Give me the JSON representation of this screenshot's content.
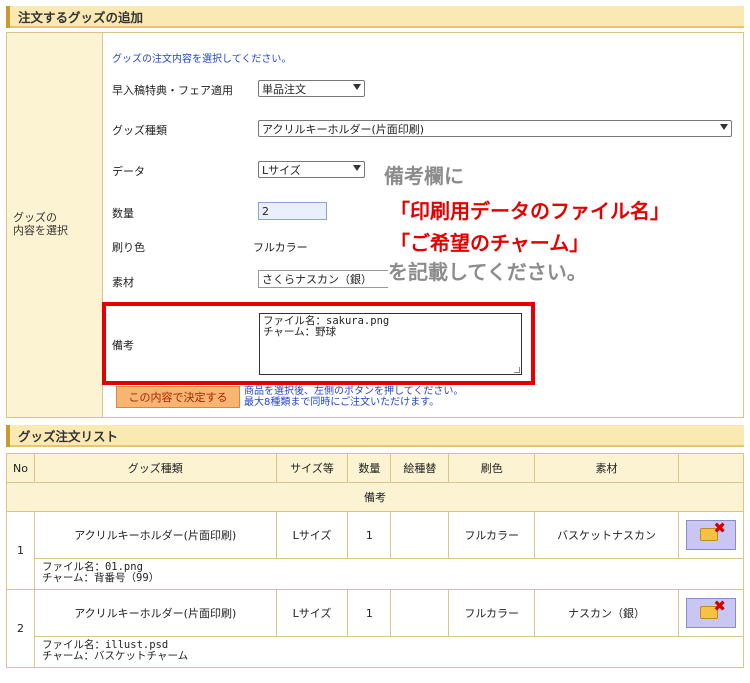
{
  "section1": {
    "title": "注文するグッズの追加"
  },
  "form": {
    "left_label": [
      "グッズの",
      "内容を選択"
    ],
    "instruction": "グッズの注文内容を選択してください。",
    "early_label": "早入稿特典・フェア適用",
    "early_value": "単品注文",
    "type_label": "グッズ種類",
    "type_value": "アクリルキーホルダー(片面印刷)",
    "data_label": "データ",
    "data_value": "Lサイズ",
    "qty_label": "数量",
    "qty_value": "2",
    "color_label": "刷り色",
    "color_value": "フルカラー",
    "material_label": "素材",
    "material_value": "さくらナスカン（銀）",
    "remarks_label": "備考",
    "remarks_lines": [
      "ファイル名：sakura.png",
      "チャーム：野球"
    ],
    "submit_label": "この内容で決定する",
    "note_lines": [
      "商品を選択後、左側のボタンを押してください。",
      "最大8種類まで同時にご注文いただけます。"
    ]
  },
  "overlay": {
    "line1": "備考欄に",
    "line2": "「印刷用データのファイル名」",
    "line3": "「ご希望のチャーム」",
    "line4": "を記載してください。"
  },
  "section2": {
    "title": "グッズ注文リスト"
  },
  "list": {
    "headers": [
      "No",
      "グッズ種類",
      "サイズ等",
      "数量",
      "絵種替",
      "刷色",
      "素材",
      ""
    ],
    "remarks_header": "備考",
    "rows": [
      {
        "no": "1",
        "type": "アクリルキーホルダー(片面印刷)",
        "size": "Lサイズ",
        "qty": "1",
        "swap": "",
        "color": "フルカラー",
        "material": "バスケットナスカン",
        "remarks": [
          "ファイル名：01.png",
          "チャーム：背番号（99）"
        ]
      },
      {
        "no": "2",
        "type": "アクリルキーホルダー(片面印刷)",
        "size": "Lサイズ",
        "qty": "1",
        "swap": "",
        "color": "フルカラー",
        "material": "ナスカン（銀）",
        "remarks": [
          "ファイル名：illust.psd",
          "チャーム：バスケットチャーム"
        ]
      }
    ]
  }
}
